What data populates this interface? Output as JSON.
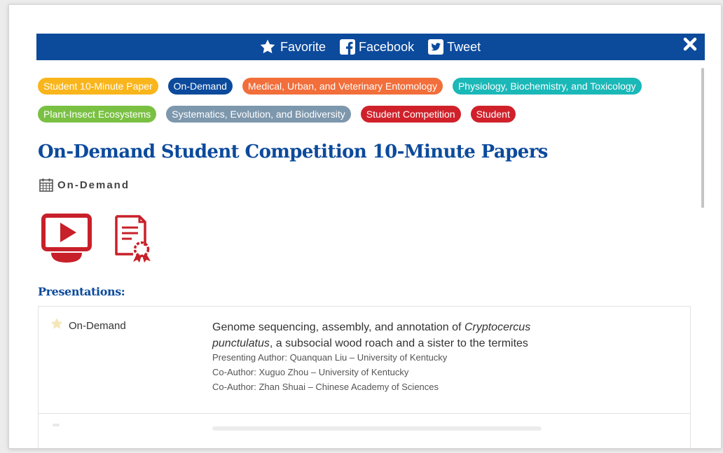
{
  "share_bar": {
    "favorite_label": "Favorite",
    "facebook_label": "Facebook",
    "tweet_label": "Tweet",
    "close_icon": "close-icon"
  },
  "tags": [
    {
      "label": "Student 10-Minute Paper",
      "color": "#f9b51c"
    },
    {
      "label": "On-Demand",
      "color": "#0c4a9c"
    },
    {
      "label": "Medical, Urban, and Veterinary Entomology",
      "color": "#f26e3a"
    },
    {
      "label": "Physiology, Biochemistry, and Toxicology",
      "color": "#1bb8b8"
    },
    {
      "label": "Plant-Insect Ecosystems",
      "color": "#7ac143"
    },
    {
      "label": "Systematics, Evolution, and Biodiversity",
      "color": "#7d97ad"
    },
    {
      "label": "Student Competition",
      "color": "#d0212b"
    },
    {
      "label": "Student",
      "color": "#d0212b"
    }
  ],
  "session": {
    "title": "On-Demand Student Competition 10-Minute Papers",
    "schedule_label": "On-Demand",
    "icons": [
      "video-play-icon",
      "certificate-icon",
      "calendar-icon"
    ]
  },
  "presentations": {
    "heading": "Presentations:",
    "items": [
      {
        "type_label": "On-Demand",
        "title_prefix": "Genome sequencing, assembly, and annotation of ",
        "title_italic": "Cryptocercus punctulatus",
        "title_suffix": ", a subsocial wood roach and a sister to the termites",
        "authors": [
          "Presenting Author: Quanquan Liu – University of Kentucky",
          "Co-Author: Xuguo Zhou – University of Kentucky",
          "Co-Author: Zhan Shuai – Chinese Academy of Sciences"
        ]
      }
    ]
  },
  "colors": {
    "brand_blue": "#0c4a9c",
    "icon_red": "#c8202a",
    "favorite_star": "#f5e6b8"
  }
}
